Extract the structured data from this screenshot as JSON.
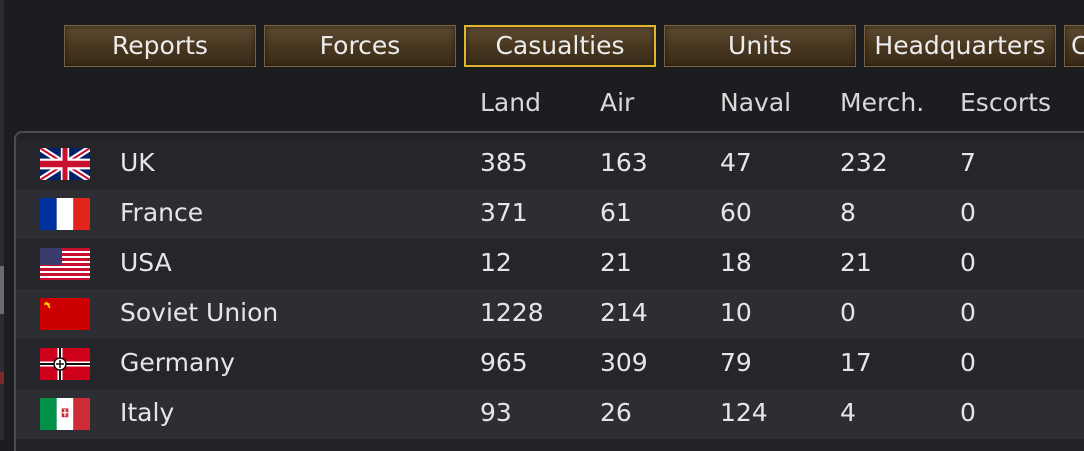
{
  "tabs": [
    {
      "label": "Reports",
      "active": false
    },
    {
      "label": "Forces",
      "active": false
    },
    {
      "label": "Casualties",
      "active": true
    },
    {
      "label": "Units",
      "active": false
    },
    {
      "label": "Headquarters",
      "active": false
    },
    {
      "label": "C",
      "active": false
    }
  ],
  "columns": [
    "Land",
    "Air",
    "Naval",
    "Merch.",
    "Escorts"
  ],
  "rows": [
    {
      "flag": "uk-flag-icon",
      "name": "UK",
      "land": "385",
      "air": "163",
      "naval": "47",
      "merch": "232",
      "escorts": "7"
    },
    {
      "flag": "france-flag-icon",
      "name": "France",
      "land": "371",
      "air": "61",
      "naval": "60",
      "merch": "8",
      "escorts": "0"
    },
    {
      "flag": "usa-flag-icon",
      "name": "USA",
      "land": "12",
      "air": "21",
      "naval": "18",
      "merch": "21",
      "escorts": "0"
    },
    {
      "flag": "soviet-flag-icon",
      "name": "Soviet Union",
      "land": "1228",
      "air": "214",
      "naval": "10",
      "merch": "0",
      "escorts": "0"
    },
    {
      "flag": "germany-flag-icon",
      "name": "Germany",
      "land": "965",
      "air": "309",
      "naval": "79",
      "merch": "17",
      "escorts": "0"
    },
    {
      "flag": "italy-flag-icon",
      "name": "Italy",
      "land": "93",
      "air": "26",
      "naval": "124",
      "merch": "4",
      "escorts": "0"
    }
  ],
  "colors": {
    "active_tab_border": "#e1b52c",
    "tab_fill": "#4a3a24"
  }
}
